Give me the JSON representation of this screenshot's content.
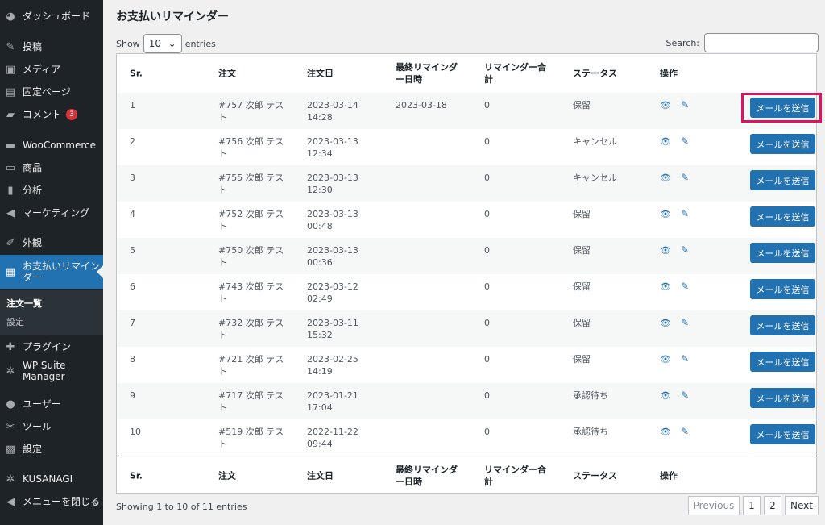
{
  "sidebar": {
    "items": [
      {
        "label": "ダッシュボード",
        "icon": "dashboard-icon"
      },
      {
        "label": "投稿",
        "icon": "pin-icon"
      },
      {
        "label": "メディア",
        "icon": "media-icon"
      },
      {
        "label": "固定ページ",
        "icon": "page-icon"
      },
      {
        "label": "コメント",
        "icon": "comment-icon",
        "badge": "3"
      },
      {
        "label": "WooCommerce",
        "icon": "woo-icon"
      },
      {
        "label": "商品",
        "icon": "archive-icon"
      },
      {
        "label": "分析",
        "icon": "chart-icon"
      },
      {
        "label": "マーケティング",
        "icon": "megaphone-icon"
      },
      {
        "label": "外観",
        "icon": "brush-icon"
      },
      {
        "label": "お支払いリマインダー",
        "icon": "reminder-icon",
        "active": true
      },
      {
        "label": "プラグイン",
        "icon": "plugin-icon"
      },
      {
        "label": "WP Suite Manager",
        "icon": "gear-icon"
      },
      {
        "label": "ユーザー",
        "icon": "user-icon"
      },
      {
        "label": "ツール",
        "icon": "wrench-icon"
      },
      {
        "label": "設定",
        "icon": "settings-icon"
      },
      {
        "label": "KUSANAGI",
        "icon": "gear-icon"
      },
      {
        "label": "メニューを閉じる",
        "icon": "collapse-icon"
      }
    ],
    "submenu": [
      {
        "label": "注文一覧",
        "current": true
      },
      {
        "label": "設定",
        "current": false
      }
    ]
  },
  "page": {
    "title": "お支払いリマインダー",
    "show_label": "Show",
    "entries_label": "entries",
    "length_value": "10",
    "search_label": "Search:",
    "search_value": ""
  },
  "table": {
    "headers": [
      "Sr.",
      "注文",
      "注文日",
      "最終リマインダー日時",
      "リマインダー合計",
      "ステータス",
      "操作"
    ],
    "button_label": "メールを送信",
    "rows": [
      {
        "sr": "1",
        "order": "#757 次郎 テスト",
        "date": "2023-03-14 14:28",
        "last": "2023-03-18",
        "count": "0",
        "status": "保留"
      },
      {
        "sr": "2",
        "order": "#756 次郎 テスト",
        "date": "2023-03-13 12:34",
        "last": "",
        "count": "0",
        "status": "キャンセル"
      },
      {
        "sr": "3",
        "order": "#755 次郎 テスト",
        "date": "2023-03-13 12:30",
        "last": "",
        "count": "0",
        "status": "キャンセル"
      },
      {
        "sr": "4",
        "order": "#752 次郎 テスト",
        "date": "2023-03-13 00:48",
        "last": "",
        "count": "0",
        "status": "保留"
      },
      {
        "sr": "5",
        "order": "#750 次郎 テスト",
        "date": "2023-03-13 00:36",
        "last": "",
        "count": "0",
        "status": "保留"
      },
      {
        "sr": "6",
        "order": "#743 次郎 テスト",
        "date": "2023-03-12 02:49",
        "last": "",
        "count": "0",
        "status": "保留"
      },
      {
        "sr": "7",
        "order": "#732 次郎 テスト",
        "date": "2023-03-11 15:32",
        "last": "",
        "count": "0",
        "status": "保留"
      },
      {
        "sr": "8",
        "order": "#721 次郎 テスト",
        "date": "2023-02-25 14:19",
        "last": "",
        "count": "0",
        "status": "保留"
      },
      {
        "sr": "9",
        "order": "#717 次郎 テスト",
        "date": "2023-01-21 17:04",
        "last": "",
        "count": "0",
        "status": "承認待ち"
      },
      {
        "sr": "10",
        "order": "#519 次郎 テスト",
        "date": "2022-11-22 09:44",
        "last": "",
        "count": "0",
        "status": "承認待ち"
      }
    ]
  },
  "footer": {
    "info": "Showing 1 to 10 of 11 entries",
    "prev": "Previous",
    "pages": [
      "1",
      "2"
    ],
    "next": "Next"
  },
  "colors": {
    "accent": "#2271b1",
    "highlight": "#e0115f",
    "sidebar": "#1d2327"
  }
}
